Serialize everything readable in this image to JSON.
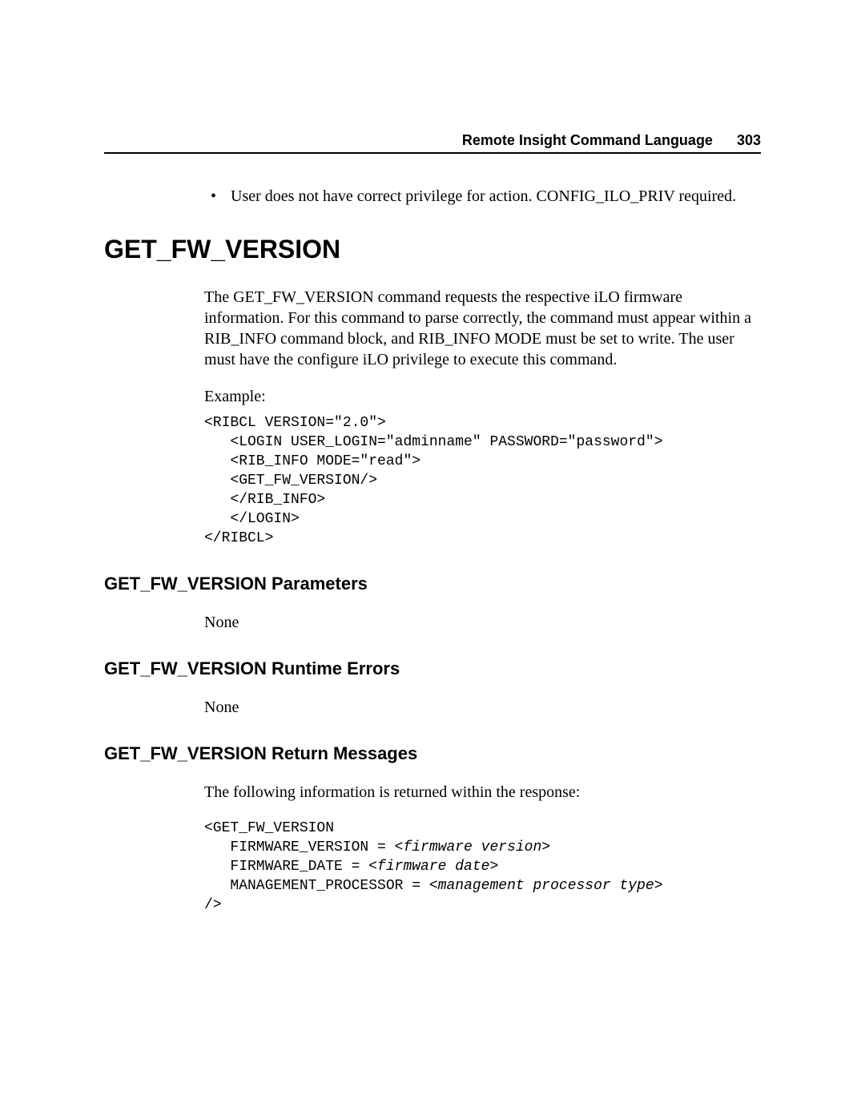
{
  "header": {
    "title": "Remote Insight Command Language",
    "page_number": "303"
  },
  "bullet": {
    "marker": "•",
    "text": "User does not have correct privilege for action. CONFIG_ILO_PRIV required."
  },
  "heading_main": "GET_FW_VERSION",
  "description": "The GET_FW_VERSION command requests the respective iLO firmware information. For this command to parse correctly, the command must appear within a RIB_INFO command block, and RIB_INFO MODE must be set to write. The user must have the configure iLO privilege to execute this command.",
  "example_label": "Example:",
  "code_example": "<RIBCL VERSION=\"2.0\">\n   <LOGIN USER_LOGIN=\"adminname\" PASSWORD=\"password\">\n   <RIB_INFO MODE=\"read\">\n   <GET_FW_VERSION/>\n   </RIB_INFO>\n   </LOGIN>\n</RIBCL>",
  "section_params": {
    "heading": "GET_FW_VERSION Parameters",
    "body": "None"
  },
  "section_errors": {
    "heading": "GET_FW_VERSION Runtime Errors",
    "body": "None"
  },
  "section_return": {
    "heading": "GET_FW_VERSION Return Messages",
    "body": "The following information is returned within the response:",
    "code_pre": "<GET_FW_VERSION\n   FIRMWARE_VERSION = ",
    "code_i1": "<firmware version>",
    "code_mid1": "\n   FIRMWARE_DATE = ",
    "code_i2": "<firmware date>",
    "code_mid2": "\n   MANAGEMENT_PROCESSOR = ",
    "code_i3": "<management processor type>",
    "code_post": "\n/>"
  }
}
